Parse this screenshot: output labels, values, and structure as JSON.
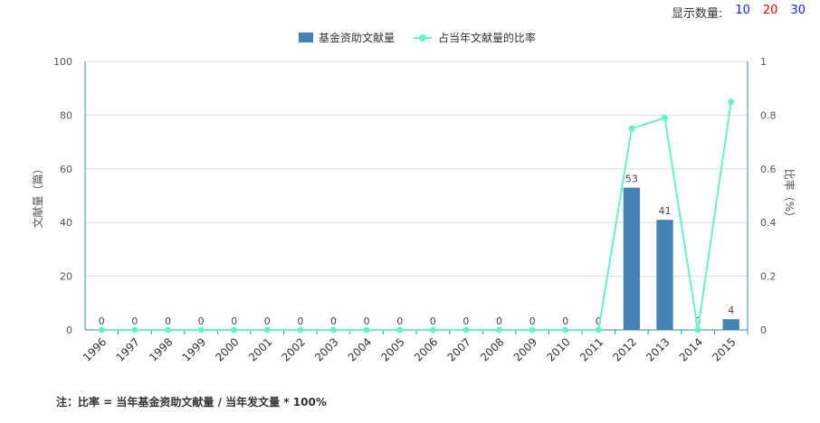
{
  "display_count": {
    "label": "显示数量:",
    "options": [
      {
        "value": "10",
        "color": "#1a1aff"
      },
      {
        "value": "20",
        "color": "#e60000"
      },
      {
        "value": "30",
        "color": "#1a1aff"
      }
    ]
  },
  "chart_data": {
    "type": "bar",
    "categories": [
      "1996",
      "1997",
      "1998",
      "1999",
      "2000",
      "2001",
      "2002",
      "2003",
      "2004",
      "2005",
      "2006",
      "2007",
      "2008",
      "2009",
      "2010",
      "2011",
      "2012",
      "2013",
      "2014",
      "2015"
    ],
    "series": [
      {
        "name": "基金资助文献量",
        "type": "bar",
        "axis": "left",
        "color": "#4682b4",
        "values": [
          0,
          0,
          0,
          0,
          0,
          0,
          0,
          0,
          0,
          0,
          0,
          0,
          0,
          0,
          0,
          0,
          53,
          41,
          0,
          4
        ]
      },
      {
        "name": "占当年文献量的比率",
        "type": "line",
        "axis": "right",
        "color": "#66f2c8",
        "values": [
          0,
          0,
          0,
          0,
          0,
          0,
          0,
          0,
          0,
          0,
          0,
          0,
          0,
          0,
          0,
          0,
          0.75,
          0.79,
          0,
          0.85
        ]
      }
    ],
    "ylabel": "文献量（篇）",
    "y2label": "比率（%）",
    "ylim": [
      0,
      100
    ],
    "y2lim": [
      0,
      1
    ],
    "yticks": [
      "0",
      "20",
      "40",
      "60",
      "80",
      "100"
    ],
    "y2ticks": [
      "0",
      "0.2",
      "0.4",
      "0.6",
      "0.8",
      "1"
    ],
    "grid": true,
    "legend_position": "top-center"
  },
  "note": "注：比率 = 当年基金资助文献量 / 当年发文量 * 100%"
}
